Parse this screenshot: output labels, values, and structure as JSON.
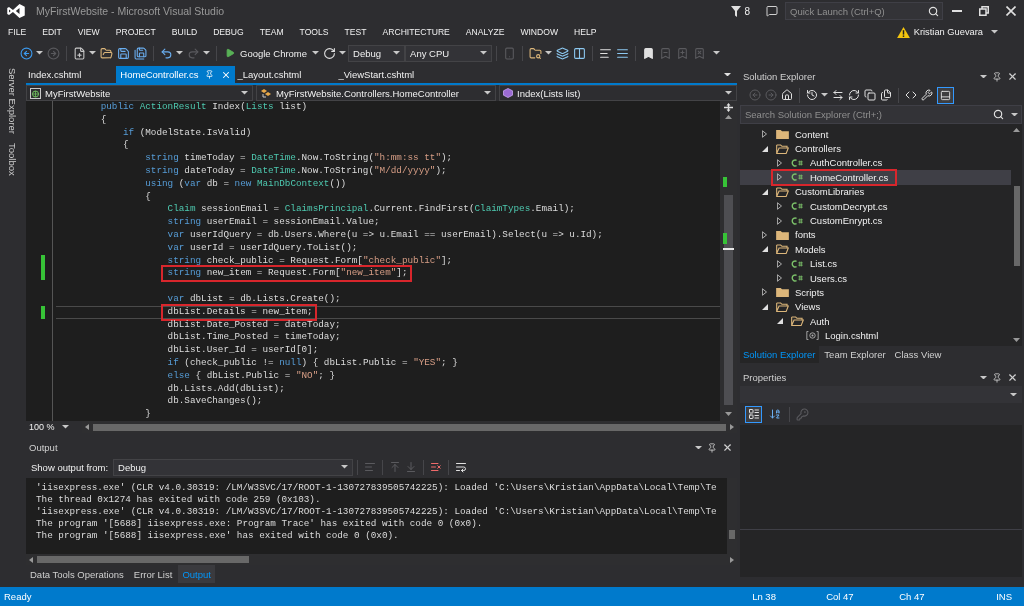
{
  "window": {
    "title": "MyFirstWebsite - Microsoft Visual Studio",
    "notification_count": "8",
    "quick_launch": {
      "placeholder": "Quick Launch (Ctrl+Q)"
    }
  },
  "menu": [
    "FILE",
    "EDIT",
    "VIEW",
    "PROJECT",
    "BUILD",
    "DEBUG",
    "TEAM",
    "TOOLS",
    "TEST",
    "ARCHITECTURE",
    "ANALYZE",
    "WINDOW",
    "HELP"
  ],
  "account": {
    "name": "Kristian Guevara"
  },
  "toolbar": [
    {
      "kind": "back",
      "disabled": false
    },
    {
      "kind": "forward",
      "disabled": true
    },
    {
      "kind": "separator"
    },
    {
      "kind": "new_file",
      "disabled": false
    },
    {
      "kind": "open",
      "disabled": false
    },
    {
      "kind": "save",
      "disabled": false
    },
    {
      "kind": "save_all",
      "disabled": false
    },
    {
      "kind": "separator"
    },
    {
      "kind": "undo",
      "disabled": false
    },
    {
      "kind": "redo",
      "disabled": true
    },
    {
      "kind": "separator"
    },
    {
      "kind": "run",
      "label": "Google Chrome"
    },
    {
      "kind": "refresh",
      "disabled": false
    },
    {
      "kind": "configuration",
      "label": "Debug"
    },
    {
      "kind": "platform",
      "label": "Any CPU"
    },
    {
      "kind": "separator"
    },
    {
      "kind": "device",
      "disabled": true
    },
    {
      "kind": "separator"
    },
    {
      "kind": "find",
      "disabled": false
    },
    {
      "kind": "layers",
      "disabled": false
    },
    {
      "kind": "columns",
      "disabled": false
    },
    {
      "kind": "separator"
    },
    {
      "kind": "align_left",
      "disabled": false
    },
    {
      "kind": "align_justify",
      "disabled": false
    },
    {
      "kind": "separator"
    },
    {
      "kind": "bookmark",
      "disabled": false
    },
    {
      "kind": "bookmark_previous",
      "disabled": true
    },
    {
      "kind": "bookmark_next",
      "disabled": true
    },
    {
      "kind": "bookmark_clear",
      "disabled": true
    },
    {
      "kind": "overflow"
    }
  ],
  "side_tabs": [
    "Server Explorer",
    "Toolbox"
  ],
  "document_tabs": [
    {
      "label": "Index.cshtml",
      "selected": false
    },
    {
      "label": "HomeController.cs",
      "selected": true
    },
    {
      "label": "_Layout.cshtml",
      "selected": false
    },
    {
      "label": "_ViewStart.cshtml",
      "selected": false
    }
  ],
  "navigation": {
    "project": "MyFirstWebsite",
    "type": "MyFirstWebsite.Controllers.HomeController",
    "member": "Index(Lists list)"
  },
  "editor": {
    "zoom": "100 %",
    "lines": [
      {
        "kind": "code",
        "tokens": [
          {
            "text": "        public ",
            "kind": "keyword"
          },
          {
            "text": "ActionResult",
            "kind": "type"
          },
          {
            "text": " Index(",
            "kind": "plain"
          },
          {
            "text": "Lists",
            "kind": "type"
          },
          {
            "text": " list)",
            "kind": "plain"
          }
        ],
        "changed": false,
        "annotated": false,
        "current": false
      },
      {
        "kind": "code",
        "tokens": [
          {
            "text": "        {",
            "kind": "plain"
          }
        ],
        "changed": false,
        "annotated": false,
        "current": false
      },
      {
        "kind": "code",
        "tokens": [
          {
            "text": "            if",
            "kind": "keyword"
          },
          {
            "text": " (ModelState.IsValid)",
            "kind": "plain"
          }
        ],
        "changed": false,
        "annotated": false,
        "current": false
      },
      {
        "kind": "code",
        "tokens": [
          {
            "text": "            {",
            "kind": "plain"
          }
        ],
        "changed": false,
        "annotated": false,
        "current": false
      },
      {
        "kind": "code",
        "tokens": [
          {
            "text": "                string",
            "kind": "keyword"
          },
          {
            "text": " timeToday = ",
            "kind": "plain"
          },
          {
            "text": "DateTime",
            "kind": "type"
          },
          {
            "text": ".Now.ToString(",
            "kind": "plain"
          },
          {
            "text": "\"h:mm:ss tt\"",
            "kind": "string"
          },
          {
            "text": ");",
            "kind": "plain"
          }
        ],
        "changed": false,
        "annotated": false,
        "current": false
      },
      {
        "kind": "code",
        "tokens": [
          {
            "text": "                string",
            "kind": "keyword"
          },
          {
            "text": " dateToday = ",
            "kind": "plain"
          },
          {
            "text": "DateTime",
            "kind": "type"
          },
          {
            "text": ".Now.ToString(",
            "kind": "plain"
          },
          {
            "text": "\"M/dd/yyyy\"",
            "kind": "string"
          },
          {
            "text": ");",
            "kind": "plain"
          }
        ],
        "changed": false,
        "annotated": false,
        "current": false
      },
      {
        "kind": "code",
        "tokens": [
          {
            "text": "                using",
            "kind": "keyword"
          },
          {
            "text": " (",
            "kind": "plain"
          },
          {
            "text": "var",
            "kind": "keyword"
          },
          {
            "text": " db = ",
            "kind": "plain"
          },
          {
            "text": "new ",
            "kind": "keyword"
          },
          {
            "text": "MainDbContext",
            "kind": "type"
          },
          {
            "text": "())",
            "kind": "plain"
          }
        ],
        "changed": false,
        "annotated": false,
        "current": false
      },
      {
        "kind": "code",
        "tokens": [
          {
            "text": "                {",
            "kind": "plain"
          }
        ],
        "changed": false,
        "annotated": false,
        "current": false
      },
      {
        "kind": "code",
        "tokens": [
          {
            "text": "                    Claim",
            "kind": "type"
          },
          {
            "text": " sessionEmail = ",
            "kind": "plain"
          },
          {
            "text": "ClaimsPrincipal",
            "kind": "type"
          },
          {
            "text": ".Current.FindFirst(",
            "kind": "plain"
          },
          {
            "text": "ClaimTypes",
            "kind": "type"
          },
          {
            "text": ".Email);",
            "kind": "plain"
          }
        ],
        "changed": false,
        "annotated": false,
        "current": false
      },
      {
        "kind": "code",
        "tokens": [
          {
            "text": "                    string",
            "kind": "keyword"
          },
          {
            "text": " userEmail = sessionEmail.Value;",
            "kind": "plain"
          }
        ],
        "changed": false,
        "annotated": false,
        "current": false
      },
      {
        "kind": "code",
        "tokens": [
          {
            "text": "                    var",
            "kind": "keyword"
          },
          {
            "text": " userIdQuery = db.Users.Where(u => u.Email == userEmail).Select(u => u.Id);",
            "kind": "plain"
          }
        ],
        "changed": false,
        "annotated": false,
        "current": false
      },
      {
        "kind": "code",
        "tokens": [
          {
            "text": "                    var",
            "kind": "keyword"
          },
          {
            "text": " userId = userIdQuery.ToList();",
            "kind": "plain"
          }
        ],
        "changed": false,
        "annotated": false,
        "current": false
      },
      {
        "kind": "code",
        "tokens": [
          {
            "text": "                    string",
            "kind": "keyword"
          },
          {
            "text": " check_public = Request.Form[",
            "kind": "plain"
          },
          {
            "text": "\"check_public\"",
            "kind": "string"
          },
          {
            "text": "];",
            "kind": "plain"
          }
        ],
        "changed": true,
        "annotated": false,
        "current": false
      },
      {
        "kind": "code",
        "tokens": [
          {
            "text": "                    string",
            "kind": "keyword"
          },
          {
            "text": " new_item = Request.Form[",
            "kind": "plain"
          },
          {
            "text": "\"new_item\"",
            "kind": "string"
          },
          {
            "text": "];",
            "kind": "plain"
          }
        ],
        "changed": true,
        "annotated": true,
        "current": false
      },
      {
        "kind": "blank"
      },
      {
        "kind": "code",
        "tokens": [
          {
            "text": "                    var",
            "kind": "keyword"
          },
          {
            "text": " dbList = db.Lists.Create();",
            "kind": "plain"
          }
        ],
        "changed": false,
        "annotated": false,
        "current": false
      },
      {
        "kind": "code",
        "tokens": [
          {
            "text": "                    dbList.Details = new_item;",
            "kind": "plain"
          }
        ],
        "changed": true,
        "annotated": true,
        "current": true
      },
      {
        "kind": "code",
        "tokens": [
          {
            "text": "                    dbList.Date_Posted = dateToday;",
            "kind": "plain"
          }
        ],
        "changed": false,
        "annotated": false,
        "current": false
      },
      {
        "kind": "code",
        "tokens": [
          {
            "text": "                    dbList.Time_Posted = timeToday;",
            "kind": "plain"
          }
        ],
        "changed": false,
        "annotated": false,
        "current": false
      },
      {
        "kind": "code",
        "tokens": [
          {
            "text": "                    dbList.User_Id = userId[0];",
            "kind": "plain"
          }
        ],
        "changed": false,
        "annotated": false,
        "current": false
      },
      {
        "kind": "code",
        "tokens": [
          {
            "text": "                    if",
            "kind": "keyword"
          },
          {
            "text": " (check_public != ",
            "kind": "plain"
          },
          {
            "text": "null",
            "kind": "keyword"
          },
          {
            "text": ") { dbList.Public = ",
            "kind": "plain"
          },
          {
            "text": "\"YES\"",
            "kind": "string"
          },
          {
            "text": "; }",
            "kind": "plain"
          }
        ],
        "changed": false,
        "annotated": false,
        "current": false
      },
      {
        "kind": "code",
        "tokens": [
          {
            "text": "                    else",
            "kind": "keyword"
          },
          {
            "text": " { dbList.Public = ",
            "kind": "plain"
          },
          {
            "text": "\"NO\"",
            "kind": "string"
          },
          {
            "text": "; }",
            "kind": "plain"
          }
        ],
        "changed": false,
        "annotated": false,
        "current": false
      },
      {
        "kind": "code",
        "tokens": [
          {
            "text": "                    db.Lists.Add(dbList);",
            "kind": "plain"
          }
        ],
        "changed": false,
        "annotated": false,
        "current": false
      },
      {
        "kind": "code",
        "tokens": [
          {
            "text": "                    db.SaveChanges();",
            "kind": "plain"
          }
        ],
        "changed": false,
        "annotated": false,
        "current": false
      },
      {
        "kind": "code",
        "tokens": [
          {
            "text": "                }",
            "kind": "plain"
          }
        ],
        "changed": false,
        "annotated": false,
        "current": false
      }
    ]
  },
  "output": {
    "title": "Output",
    "source_label": "Show output from:",
    "source": "Debug",
    "toolbar": [
      {
        "kind": "find_message",
        "disabled": true
      },
      {
        "kind": "separator"
      },
      {
        "kind": "previous",
        "disabled": true
      },
      {
        "kind": "next",
        "disabled": true
      },
      {
        "kind": "separator"
      },
      {
        "kind": "clear_all",
        "disabled": false
      },
      {
        "kind": "separator"
      },
      {
        "kind": "word_wrap",
        "disabled": false
      }
    ],
    "lines": [
      "'iisexpress.exe' (CLR v4.0.30319: /LM/W3SVC/17/ROOT-1-130727839505742225): Loaded 'C:\\Users\\Kristian\\AppData\\Local\\Temp\\Te",
      "The thread 0x1274 has exited with code 259 (0x103).",
      "'iisexpress.exe' (CLR v4.0.30319: /LM/W3SVC/17/ROOT-1-130727839505742225): Loaded 'C:\\Users\\Kristian\\AppData\\Local\\Temp\\Te",
      "The program '[5688] iisexpress.exe: Program Trace' has exited with code 0 (0x0).",
      "The program '[5688] iisexpress.exe' has exited with code 0 (0x0)."
    ]
  },
  "bottom_tabs": [
    {
      "label": "Data Tools Operations",
      "selected": false
    },
    {
      "label": "Error List",
      "selected": false
    },
    {
      "label": "Output",
      "selected": true
    }
  ],
  "solution_explorer": {
    "title": "Solution Explorer",
    "toolbar": [
      {
        "kind": "back",
        "disabled": true
      },
      {
        "kind": "forward",
        "disabled": true
      },
      {
        "kind": "home",
        "disabled": false
      },
      {
        "kind": "separator"
      },
      {
        "kind": "history",
        "disabled": false
      },
      {
        "kind": "sync",
        "disabled": false
      },
      {
        "kind": "refresh",
        "disabled": false
      },
      {
        "kind": "collapse",
        "disabled": false
      },
      {
        "kind": "show_all",
        "disabled": false
      },
      {
        "kind": "separator"
      },
      {
        "kind": "code_view",
        "disabled": false
      },
      {
        "kind": "properties",
        "disabled": false
      },
      {
        "kind": "preview",
        "selected": true
      }
    ],
    "search": {
      "placeholder": "Search Solution Explorer (Ctrl+;)"
    },
    "tree": [
      {
        "label": "Content",
        "kind": "folder",
        "expanded": false,
        "selected": false,
        "annotated": false
      },
      {
        "label": "Controllers",
        "kind": "folder",
        "expanded": true,
        "selected": false,
        "annotated": false,
        "children": [
          {
            "label": "AuthController.cs",
            "kind": "csharp",
            "expanded": false,
            "selected": false,
            "annotated": false
          },
          {
            "label": "HomeController.cs",
            "kind": "csharp",
            "expanded": false,
            "selected": true,
            "annotated": true
          }
        ]
      },
      {
        "label": "CustomLibraries",
        "kind": "folder",
        "expanded": true,
        "selected": false,
        "annotated": false,
        "children": [
          {
            "label": "CustomDecrypt.cs",
            "kind": "csharp",
            "expanded": false,
            "selected": false,
            "annotated": false
          },
          {
            "label": "CustomEnrypt.cs",
            "kind": "csharp",
            "expanded": false,
            "selected": false,
            "annotated": false
          }
        ]
      },
      {
        "label": "fonts",
        "kind": "folder",
        "expanded": false,
        "selected": false,
        "annotated": false
      },
      {
        "label": "Models",
        "kind": "folder",
        "expanded": true,
        "selected": false,
        "annotated": false,
        "children": [
          {
            "label": "List.cs",
            "kind": "csharp",
            "expanded": false,
            "selected": false,
            "annotated": false
          },
          {
            "label": "Users.cs",
            "kind": "csharp",
            "expanded": false,
            "selected": false,
            "annotated": false
          }
        ]
      },
      {
        "label": "Scripts",
        "kind": "folder",
        "expanded": false,
        "selected": false,
        "annotated": false
      },
      {
        "label": "Views",
        "kind": "folder",
        "expanded": true,
        "selected": false,
        "annotated": false,
        "children": [
          {
            "label": "Auth",
            "kind": "folder",
            "expanded": true,
            "selected": false,
            "annotated": false,
            "children": [
              {
                "label": "Login.cshtml",
                "kind": "razor",
                "selected": false,
                "annotated": false
              }
            ]
          }
        ]
      }
    ],
    "tabs": [
      {
        "label": "Solution Explorer",
        "selected": true
      },
      {
        "label": "Team Explorer",
        "selected": false
      },
      {
        "label": "Class View",
        "selected": false
      }
    ]
  },
  "properties": {
    "title": "Properties",
    "toolbar": [
      {
        "kind": "categorized",
        "selected": true
      },
      {
        "kind": "alphabetical",
        "selected": false
      },
      {
        "kind": "separator"
      },
      {
        "kind": "property_pages",
        "disabled": true
      }
    ]
  },
  "status_bar": {
    "message": "Ready",
    "line": "Ln 38",
    "column": "Col 47",
    "character": "Ch 47",
    "mode": "INS"
  }
}
